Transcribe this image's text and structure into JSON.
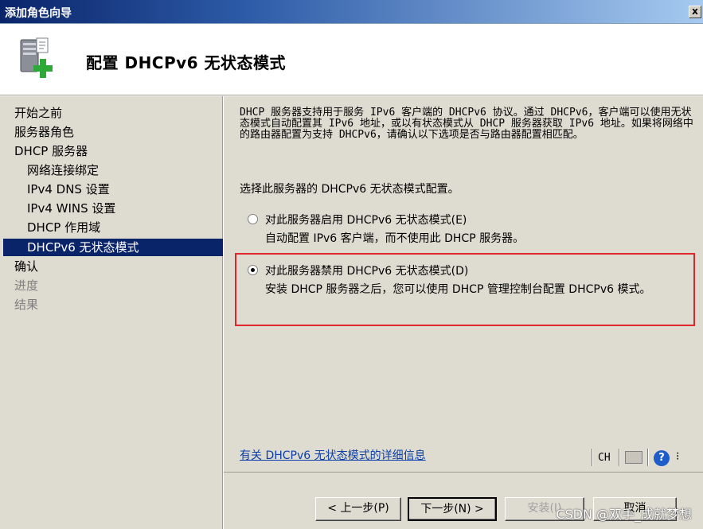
{
  "window": {
    "title": "添加角色向导",
    "close_label": "x"
  },
  "header": {
    "heading": "配置 DHCPv6 无状态模式"
  },
  "sidebar": {
    "steps": [
      {
        "label": "开始之前"
      },
      {
        "label": "服务器角色"
      },
      {
        "label": "DHCP 服务器"
      },
      {
        "label": "网络连接绑定"
      },
      {
        "label": "IPv4 DNS 设置"
      },
      {
        "label": "IPv4 WINS 设置"
      },
      {
        "label": "DHCP 作用域"
      },
      {
        "label": "DHCPv6 无状态模式"
      },
      {
        "label": "确认"
      },
      {
        "label": "进度"
      },
      {
        "label": "结果"
      }
    ]
  },
  "content": {
    "description": "DHCP 服务器支持用于服务 IPv6 客户端的 DHCPv6 协议。通过 DHCPv6，客户端可以使用无状态模式自动配置其 IPv6 地址，或以有状态模式从 DHCP 服务器获取 IPv6 地址。如果将网络中的路由器配置为支持 DHCPv6，请确认以下选项是否与路由器配置相匹配。",
    "prompt": "选择此服务器的 DHCPv6 无状态模式配置。",
    "options": [
      {
        "label": "对此服务器启用 DHCPv6 无状态模式(E)",
        "description": "自动配置 IPv6 客户端，而不使用此 DHCP 服务器。",
        "checked": false
      },
      {
        "label": "对此服务器禁用 DHCPv6 无状态模式(D)",
        "description": "安装 DHCP 服务器之后，您可以使用 DHCP 管理控制台配置 DHCPv6 模式。",
        "checked": true
      }
    ],
    "more_info_link": "有关 DHCPv6 无状态模式的详细信息"
  },
  "langbar": {
    "language": "CH",
    "help": "?",
    "more": "⁝"
  },
  "footer": {
    "prev_label": "< 上一步(P)",
    "next_label": "下一步(N) >",
    "install_label": "安装(I)",
    "cancel_label": "取消"
  },
  "watermark": "CSDN @双手_成就梦想",
  "colors": {
    "selection": "#0a246a",
    "highlight_box": "#e0262b",
    "link": "#0b3eaa",
    "panel": "#dedbd1"
  }
}
